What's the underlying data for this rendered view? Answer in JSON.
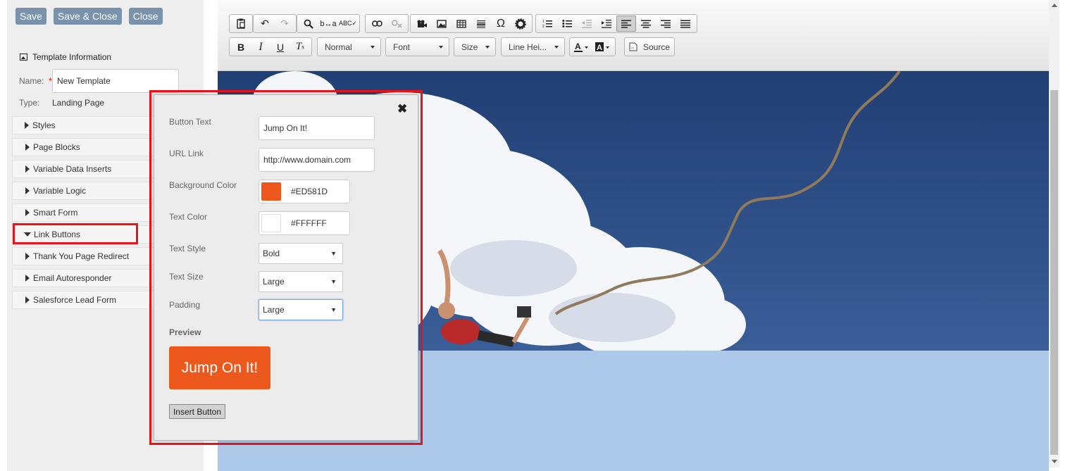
{
  "top_buttons": {
    "save": "Save",
    "save_close": "Save & Close",
    "close": "Close"
  },
  "template_info": {
    "title": "Template Information",
    "name_label": "Name:",
    "required_mark": "*",
    "name_value": "New Template",
    "type_label": "Type:",
    "type_value": "Landing Page"
  },
  "accordion": [
    {
      "label": "Styles",
      "expanded": false
    },
    {
      "label": "Page Blocks",
      "expanded": false
    },
    {
      "label": "Variable Data Inserts",
      "expanded": false
    },
    {
      "label": "Variable Logic",
      "expanded": false
    },
    {
      "label": "Smart Form",
      "expanded": false
    },
    {
      "label": "Link Buttons",
      "expanded": true
    },
    {
      "label": "Thank You Page Redirect",
      "expanded": false
    },
    {
      "label": "Email Autoresponder",
      "expanded": false
    },
    {
      "label": "Salesforce Lead Form",
      "expanded": false
    }
  ],
  "toolbar": {
    "format": "Normal",
    "font": "Font",
    "size": "Size",
    "line_height": "Line Hei...",
    "source": "Source"
  },
  "dialog": {
    "close": "✖",
    "button_text_label": "Button Text",
    "button_text_value": "Jump On It!",
    "url_label": "URL Link",
    "url_value": "http://www.domain.com",
    "bg_color_label": "Background Color",
    "bg_color_value": "#ED581D",
    "text_color_label": "Text Color",
    "text_color_value": "#FFFFFF",
    "text_style_label": "Text Style",
    "text_style_value": "Bold",
    "text_size_label": "Text Size",
    "text_size_value": "Large",
    "padding_label": "Padding",
    "padding_value": "Large",
    "preview_label": "Preview",
    "preview_button": "Jump On It!",
    "insert_button": "Insert Button"
  },
  "colors": {
    "button_bg": "#ED581D",
    "highlight": "#E8141C",
    "editor_bg": "#ADC9EA",
    "sky": "#2C4C7F"
  }
}
